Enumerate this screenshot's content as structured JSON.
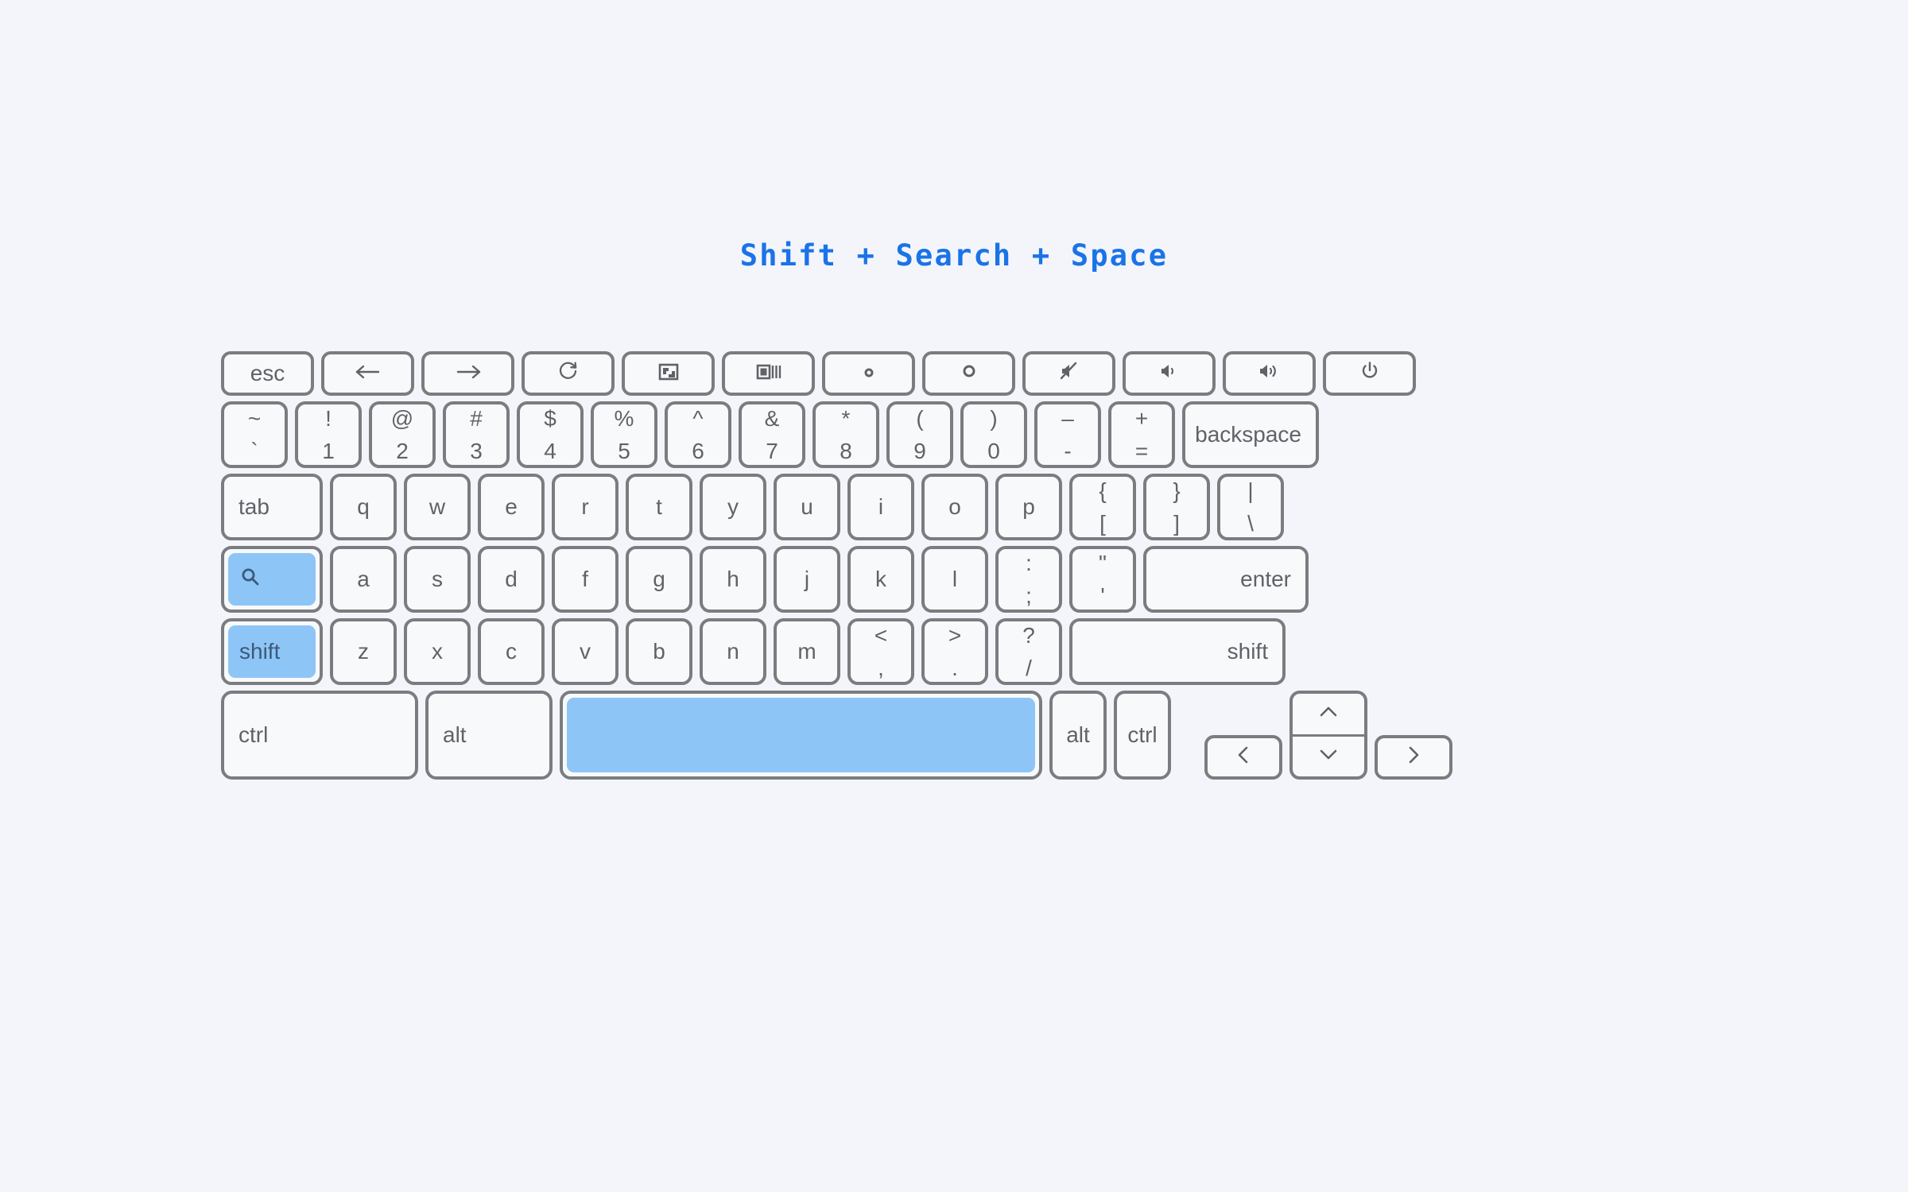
{
  "title": "Shift + Search + Space",
  "colors": {
    "background": "#f4f5fa",
    "key_border": "#7a7d80",
    "key_face": "#f8f9fb",
    "key_text": "#5f6368",
    "highlight": "#8ec5f7",
    "title_accent": "#1a73e8"
  },
  "keyboard": {
    "type": "chromebook",
    "rows": {
      "function_row": [
        {
          "label": "esc",
          "icon": null
        },
        {
          "label": "",
          "icon": "arrow-left-icon"
        },
        {
          "label": "",
          "icon": "arrow-right-icon"
        },
        {
          "label": "",
          "icon": "refresh-icon"
        },
        {
          "label": "",
          "icon": "fullscreen-icon"
        },
        {
          "label": "",
          "icon": "overview-windows-icon"
        },
        {
          "label": "",
          "icon": "brightness-down-icon"
        },
        {
          "label": "",
          "icon": "brightness-up-icon"
        },
        {
          "label": "",
          "icon": "volume-mute-icon"
        },
        {
          "label": "",
          "icon": "volume-down-icon"
        },
        {
          "label": "",
          "icon": "volume-up-icon"
        },
        {
          "label": "",
          "icon": "power-icon"
        }
      ],
      "number_row": [
        {
          "upper": "~",
          "lower": "`"
        },
        {
          "upper": "!",
          "lower": "1"
        },
        {
          "upper": "@",
          "lower": "2"
        },
        {
          "upper": "#",
          "lower": "3"
        },
        {
          "upper": "$",
          "lower": "4"
        },
        {
          "upper": "%",
          "lower": "5"
        },
        {
          "upper": "^",
          "lower": "6"
        },
        {
          "upper": "&",
          "lower": "7"
        },
        {
          "upper": "*",
          "lower": "8"
        },
        {
          "upper": "(",
          "lower": "9"
        },
        {
          "upper": ")",
          "lower": "0"
        },
        {
          "upper": "–",
          "lower": "-"
        },
        {
          "upper": "+",
          "lower": "="
        },
        {
          "label": "backspace"
        }
      ],
      "top_row": [
        {
          "label": "tab"
        },
        {
          "label": "q"
        },
        {
          "label": "w"
        },
        {
          "label": "e"
        },
        {
          "label": "r"
        },
        {
          "label": "t"
        },
        {
          "label": "y"
        },
        {
          "label": "u"
        },
        {
          "label": "i"
        },
        {
          "label": "o"
        },
        {
          "label": "p"
        },
        {
          "upper": "{",
          "lower": "["
        },
        {
          "upper": "}",
          "lower": "]"
        },
        {
          "upper": "|",
          "lower": "\\"
        }
      ],
      "home_row": [
        {
          "label": "",
          "icon": "search-icon",
          "highlighted": true
        },
        {
          "label": "a"
        },
        {
          "label": "s"
        },
        {
          "label": "d"
        },
        {
          "label": "f"
        },
        {
          "label": "g"
        },
        {
          "label": "h"
        },
        {
          "label": "j"
        },
        {
          "label": "k"
        },
        {
          "label": "l"
        },
        {
          "upper": ":",
          "lower": ";"
        },
        {
          "upper": "\"",
          "lower": "'"
        },
        {
          "label": "enter"
        }
      ],
      "shift_row": [
        {
          "label": "shift",
          "highlighted": true
        },
        {
          "label": "z"
        },
        {
          "label": "x"
        },
        {
          "label": "c"
        },
        {
          "label": "v"
        },
        {
          "label": "b"
        },
        {
          "label": "n"
        },
        {
          "label": "m"
        },
        {
          "upper": "<",
          "lower": ","
        },
        {
          "upper": ">",
          "lower": "."
        },
        {
          "upper": "?",
          "lower": "/"
        },
        {
          "label": "shift"
        }
      ],
      "bottom_row": [
        {
          "label": "ctrl"
        },
        {
          "label": "alt"
        },
        {
          "label": "",
          "name": "space",
          "highlighted": true
        },
        {
          "label": "alt"
        },
        {
          "label": "ctrl"
        },
        {
          "label": "",
          "icon": "arrow-left-icon"
        },
        {
          "label": "",
          "icon": "arrow-up-icon"
        },
        {
          "label": "",
          "icon": "arrow-down-icon"
        },
        {
          "label": "",
          "icon": "arrow-right-icon"
        }
      ]
    },
    "highlighted_keys": [
      "shift",
      "search",
      "space"
    ]
  }
}
